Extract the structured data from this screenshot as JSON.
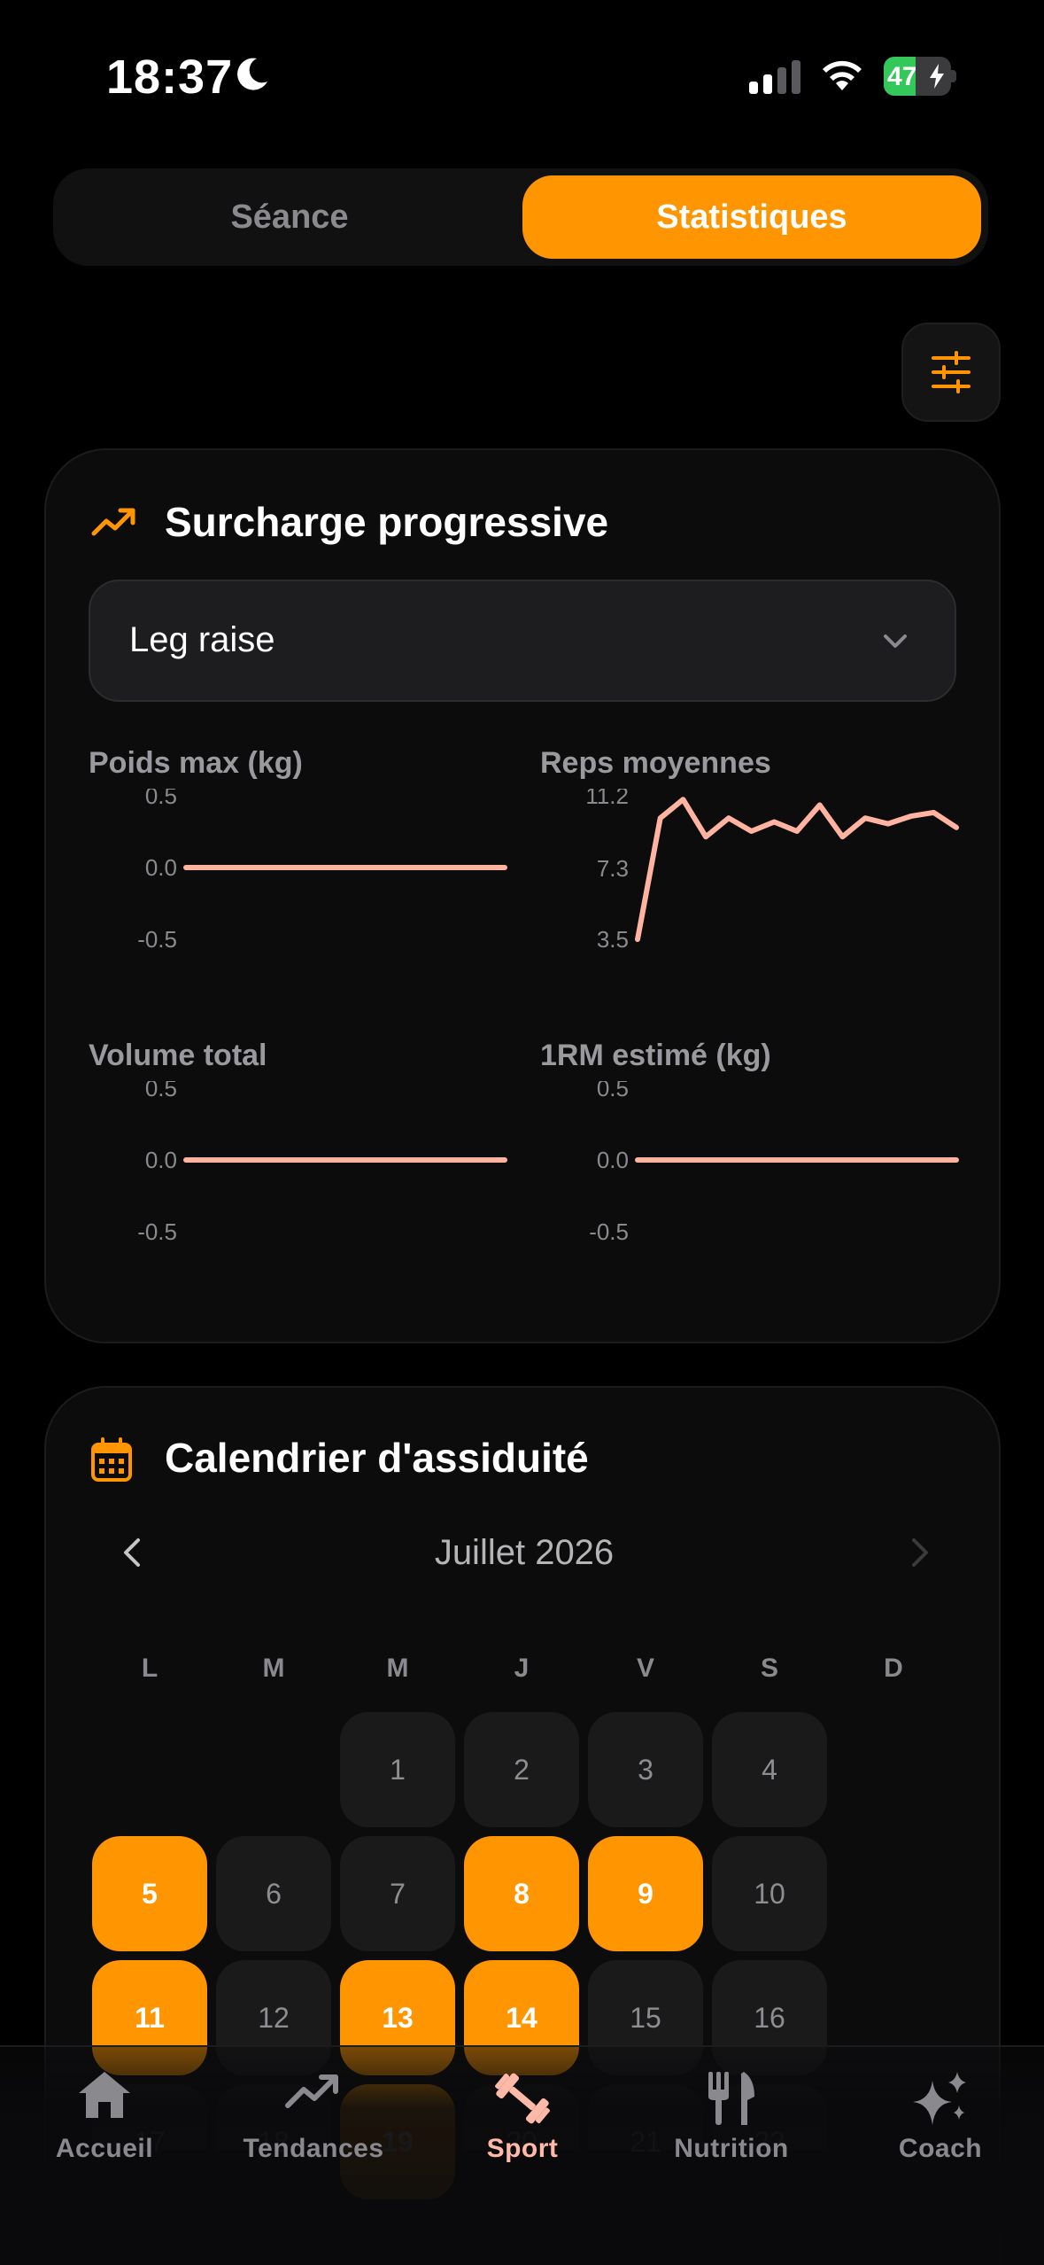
{
  "status_bar": {
    "time": "18:37",
    "battery": "47",
    "battery_level": 0.47
  },
  "segments": {
    "left": "Séance",
    "right": "Statistiques",
    "active": "right"
  },
  "progression": {
    "title": "Surcharge progressive",
    "exercise": "Leg raise",
    "charts": [
      {
        "title": "Poids max (kg)",
        "type": "line",
        "ticks": [
          "0.5",
          "0.0",
          "-0.5"
        ],
        "ylim": [
          -0.5,
          0.5
        ],
        "values": [
          0,
          0,
          0,
          0,
          0,
          0,
          0,
          0,
          0,
          0,
          0,
          0,
          0,
          0
        ]
      },
      {
        "title": "Reps moyennes",
        "type": "line",
        "ticks": [
          "11.2",
          "7.3",
          "3.5"
        ],
        "ylim": [
          3.5,
          11.2
        ],
        "values": [
          3.5,
          10.0,
          11.0,
          9.0,
          10.0,
          9.3,
          9.8,
          9.3,
          10.7,
          9.0,
          10.0,
          9.7,
          10.1,
          10.3,
          9.5
        ]
      },
      {
        "title": "Volume total",
        "type": "line",
        "ticks": [
          "0.5",
          "0.0",
          "-0.5"
        ],
        "ylim": [
          -0.5,
          0.5
        ],
        "values": [
          0,
          0,
          0,
          0,
          0,
          0,
          0,
          0,
          0,
          0,
          0,
          0,
          0,
          0
        ]
      },
      {
        "title": "1RM estimé (kg)",
        "type": "line",
        "ticks": [
          "0.5",
          "0.0",
          "-0.5"
        ],
        "ylim": [
          -0.5,
          0.5
        ],
        "values": [
          0,
          0,
          0,
          0,
          0,
          0,
          0,
          0,
          0,
          0,
          0,
          0,
          0,
          0
        ]
      }
    ]
  },
  "calendar": {
    "title": "Calendrier d'assiduité",
    "month": "Juillet 2026",
    "weekdays": [
      "L",
      "M",
      "M",
      "J",
      "V",
      "S",
      "D"
    ],
    "weeks": [
      [
        null,
        null,
        {
          "d": "1",
          "on": false
        },
        {
          "d": "2",
          "on": false
        },
        {
          "d": "3",
          "on": false
        },
        {
          "d": "4",
          "on": false
        },
        null
      ],
      [
        {
          "d": "5",
          "on": true
        },
        {
          "d": "6",
          "on": false
        },
        {
          "d": "7",
          "on": false
        },
        {
          "d": "8",
          "on": true
        },
        {
          "d": "9",
          "on": true
        },
        {
          "d": "10",
          "on": false
        },
        null
      ],
      [
        {
          "d": "11",
          "on": true
        },
        {
          "d": "12",
          "on": false
        },
        {
          "d": "13",
          "on": true
        },
        {
          "d": "14",
          "on": true
        },
        {
          "d": "15",
          "on": false
        },
        {
          "d": "16",
          "on": false
        },
        null
      ],
      [
        {
          "d": "17",
          "on": false
        },
        {
          "d": "18",
          "on": false
        },
        {
          "d": "19",
          "on": true
        },
        {
          "d": "20",
          "on": false
        },
        {
          "d": "21",
          "on": false
        },
        {
          "d": "22",
          "on": false
        },
        null
      ]
    ]
  },
  "tabbar": {
    "items": [
      {
        "label": "Accueil",
        "icon": "home-icon"
      },
      {
        "label": "Tendances",
        "icon": "trend-icon"
      },
      {
        "label": "Sport",
        "icon": "dumbbell-icon"
      },
      {
        "label": "Nutrition",
        "icon": "fork-knife-icon"
      },
      {
        "label": "Coach",
        "icon": "sparkles-icon"
      }
    ],
    "active": "Sport"
  },
  "colors": {
    "accent": "#ff9500",
    "line": "#ffb3a0",
    "active_tab": "#ffb9a8"
  }
}
